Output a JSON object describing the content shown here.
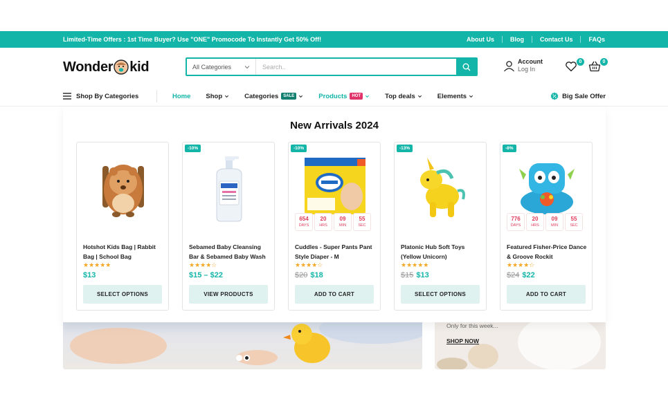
{
  "topbar": {
    "offer": "Limited-Time Offers : 1st Time Buyer? Use \"ONE\" Promocode To Instantly Get 50% Off!",
    "links": [
      "About Us",
      "Blog",
      "Contact Us",
      "FAQs"
    ]
  },
  "header": {
    "logo_left": "Wonder",
    "logo_right": "kid",
    "category_select": "All Categories",
    "search_placeholder": "Search..",
    "account_label": "Account",
    "login_label": "Log In",
    "wishlist_count": "0",
    "cart_count": "0"
  },
  "nav": {
    "by_categories": "Shop By Categories",
    "items": [
      {
        "label": "Home",
        "active": true
      },
      {
        "label": "Shop"
      },
      {
        "label": "Categories",
        "badge": "SALE"
      },
      {
        "label": "Products",
        "badge": "HOT",
        "active": true
      },
      {
        "label": "Top deals"
      },
      {
        "label": "Elements"
      }
    ],
    "big_sale": "Big Sale Offer"
  },
  "panel": {
    "title": "New Arrivals 2024",
    "products": [
      {
        "name": "Hotshot Kids Bag | Rabbit Bag | School Bag",
        "discount": "",
        "rating": "★★★★★",
        "old_price": "",
        "price": "$13",
        "button": "SELECT OPTIONS"
      },
      {
        "name": "Sebamed Baby Cleansing Bar & Sebamed Baby Wash",
        "discount": "-10%",
        "rating": "★★★★☆",
        "old_price": "",
        "price": "$15 – $22",
        "button": "VIEW PRODUCTS"
      },
      {
        "name": "Cuddles - Super Pants Pant Style Diaper - M",
        "discount": "-10%",
        "rating": "★★★★☆",
        "old_price": "$20",
        "price": "$18",
        "button": "ADD TO CART",
        "timer": {
          "days": "654",
          "hrs": "20",
          "min": "09",
          "sec": "55"
        }
      },
      {
        "name": "Platonic Hub Soft Toys (Yellow Unicorn)",
        "discount": "-13%",
        "rating": "★★★★★",
        "old_price": "$15",
        "price": "$13",
        "button": "SELECT OPTIONS"
      },
      {
        "name": "Featured Fisher-Price Dance & Groove Rockit",
        "discount": "-8%",
        "rating": "★★★★☆",
        "old_price": "$24",
        "price": "$22",
        "button": "ADD TO CART",
        "timer": {
          "days": "776",
          "hrs": "20",
          "min": "09",
          "sec": "55"
        }
      }
    ],
    "timer_labels": {
      "days": "DAYS",
      "hrs": "HRS",
      "min": "MIN",
      "sec": "SEC"
    }
  },
  "banner_right": {
    "text": "Only for this week...",
    "link": "SHOP NOW"
  },
  "colors": {
    "accent": "#13b5a8",
    "hot": "#e0336a",
    "sale": "#13806f",
    "star": "#f5a623"
  }
}
